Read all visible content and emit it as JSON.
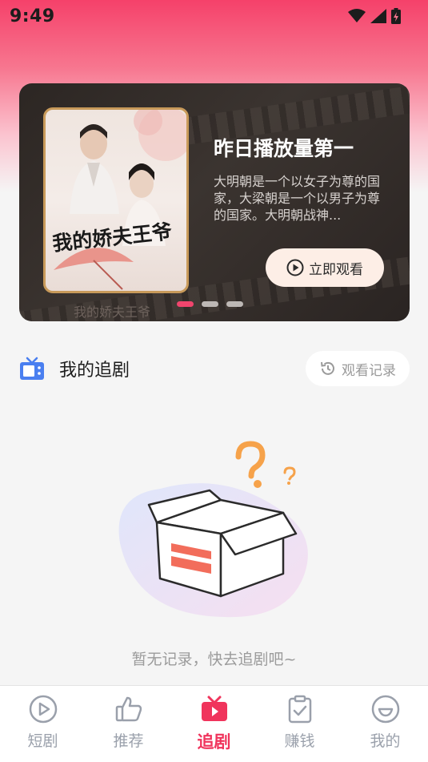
{
  "status_bar": {
    "time": "9:49"
  },
  "banner": {
    "title": "昨日播放量第一",
    "description": "大明朝是一个以女子为尊的国家，大梁朝是一个以男子为尊的国家。大明朝战神...",
    "watch_button_label": "立即观看",
    "poster_title": "我的娇夫王爷",
    "poster_caption": "我的娇夫王爷",
    "carousel_total": 3,
    "carousel_active_index": 0
  },
  "section": {
    "title": "我的追剧",
    "history_button_label": "观看记录"
  },
  "empty_state": {
    "message": "暂无记录，快去追剧吧~"
  },
  "bottom_nav": {
    "items": [
      {
        "label": "短剧",
        "icon": "play-circle-icon",
        "active": false
      },
      {
        "label": "推荐",
        "icon": "thumbs-up-icon",
        "active": false
      },
      {
        "label": "追剧",
        "icon": "tv-icon",
        "active": true
      },
      {
        "label": "赚钱",
        "icon": "clipboard-check-icon",
        "active": false
      },
      {
        "label": "我的",
        "icon": "smile-face-icon",
        "active": false
      }
    ]
  },
  "colors": {
    "accent": "#f0345c",
    "header_gradient_top": "#f5416a",
    "banner_button_bg": "#fdeee6",
    "nav_inactive": "#9aa0ab",
    "section_icon": "#4a7ff0"
  }
}
